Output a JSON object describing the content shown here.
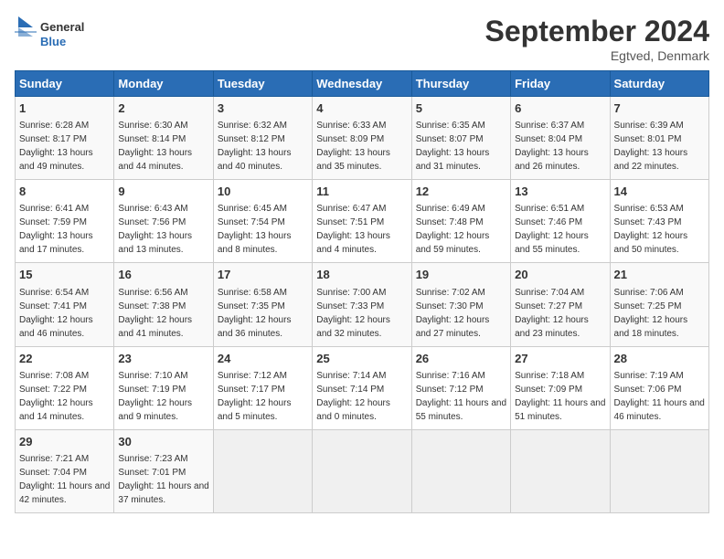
{
  "logo": {
    "general": "General",
    "blue": "Blue"
  },
  "title": "September 2024",
  "location": "Egtved, Denmark",
  "days_of_week": [
    "Sunday",
    "Monday",
    "Tuesday",
    "Wednesday",
    "Thursday",
    "Friday",
    "Saturday"
  ],
  "weeks": [
    [
      {
        "day": "1",
        "sunrise": "6:28 AM",
        "sunset": "8:17 PM",
        "daylight": "13 hours and 49 minutes."
      },
      {
        "day": "2",
        "sunrise": "6:30 AM",
        "sunset": "8:14 PM",
        "daylight": "13 hours and 44 minutes."
      },
      {
        "day": "3",
        "sunrise": "6:32 AM",
        "sunset": "8:12 PM",
        "daylight": "13 hours and 40 minutes."
      },
      {
        "day": "4",
        "sunrise": "6:33 AM",
        "sunset": "8:09 PM",
        "daylight": "13 hours and 35 minutes."
      },
      {
        "day": "5",
        "sunrise": "6:35 AM",
        "sunset": "8:07 PM",
        "daylight": "13 hours and 31 minutes."
      },
      {
        "day": "6",
        "sunrise": "6:37 AM",
        "sunset": "8:04 PM",
        "daylight": "13 hours and 26 minutes."
      },
      {
        "day": "7",
        "sunrise": "6:39 AM",
        "sunset": "8:01 PM",
        "daylight": "13 hours and 22 minutes."
      }
    ],
    [
      {
        "day": "8",
        "sunrise": "6:41 AM",
        "sunset": "7:59 PM",
        "daylight": "13 hours and 17 minutes."
      },
      {
        "day": "9",
        "sunrise": "6:43 AM",
        "sunset": "7:56 PM",
        "daylight": "13 hours and 13 minutes."
      },
      {
        "day": "10",
        "sunrise": "6:45 AM",
        "sunset": "7:54 PM",
        "daylight": "13 hours and 8 minutes."
      },
      {
        "day": "11",
        "sunrise": "6:47 AM",
        "sunset": "7:51 PM",
        "daylight": "13 hours and 4 minutes."
      },
      {
        "day": "12",
        "sunrise": "6:49 AM",
        "sunset": "7:48 PM",
        "daylight": "12 hours and 59 minutes."
      },
      {
        "day": "13",
        "sunrise": "6:51 AM",
        "sunset": "7:46 PM",
        "daylight": "12 hours and 55 minutes."
      },
      {
        "day": "14",
        "sunrise": "6:53 AM",
        "sunset": "7:43 PM",
        "daylight": "12 hours and 50 minutes."
      }
    ],
    [
      {
        "day": "15",
        "sunrise": "6:54 AM",
        "sunset": "7:41 PM",
        "daylight": "12 hours and 46 minutes."
      },
      {
        "day": "16",
        "sunrise": "6:56 AM",
        "sunset": "7:38 PM",
        "daylight": "12 hours and 41 minutes."
      },
      {
        "day": "17",
        "sunrise": "6:58 AM",
        "sunset": "7:35 PM",
        "daylight": "12 hours and 36 minutes."
      },
      {
        "day": "18",
        "sunrise": "7:00 AM",
        "sunset": "7:33 PM",
        "daylight": "12 hours and 32 minutes."
      },
      {
        "day": "19",
        "sunrise": "7:02 AM",
        "sunset": "7:30 PM",
        "daylight": "12 hours and 27 minutes."
      },
      {
        "day": "20",
        "sunrise": "7:04 AM",
        "sunset": "7:27 PM",
        "daylight": "12 hours and 23 minutes."
      },
      {
        "day": "21",
        "sunrise": "7:06 AM",
        "sunset": "7:25 PM",
        "daylight": "12 hours and 18 minutes."
      }
    ],
    [
      {
        "day": "22",
        "sunrise": "7:08 AM",
        "sunset": "7:22 PM",
        "daylight": "12 hours and 14 minutes."
      },
      {
        "day": "23",
        "sunrise": "7:10 AM",
        "sunset": "7:19 PM",
        "daylight": "12 hours and 9 minutes."
      },
      {
        "day": "24",
        "sunrise": "7:12 AM",
        "sunset": "7:17 PM",
        "daylight": "12 hours and 5 minutes."
      },
      {
        "day": "25",
        "sunrise": "7:14 AM",
        "sunset": "7:14 PM",
        "daylight": "12 hours and 0 minutes."
      },
      {
        "day": "26",
        "sunrise": "7:16 AM",
        "sunset": "7:12 PM",
        "daylight": "11 hours and 55 minutes."
      },
      {
        "day": "27",
        "sunrise": "7:18 AM",
        "sunset": "7:09 PM",
        "daylight": "11 hours and 51 minutes."
      },
      {
        "day": "28",
        "sunrise": "7:19 AM",
        "sunset": "7:06 PM",
        "daylight": "11 hours and 46 minutes."
      }
    ],
    [
      {
        "day": "29",
        "sunrise": "7:21 AM",
        "sunset": "7:04 PM",
        "daylight": "11 hours and 42 minutes."
      },
      {
        "day": "30",
        "sunrise": "7:23 AM",
        "sunset": "7:01 PM",
        "daylight": "11 hours and 37 minutes."
      },
      null,
      null,
      null,
      null,
      null
    ]
  ],
  "labels": {
    "sunrise": "Sunrise:",
    "sunset": "Sunset:",
    "daylight": "Daylight:"
  }
}
